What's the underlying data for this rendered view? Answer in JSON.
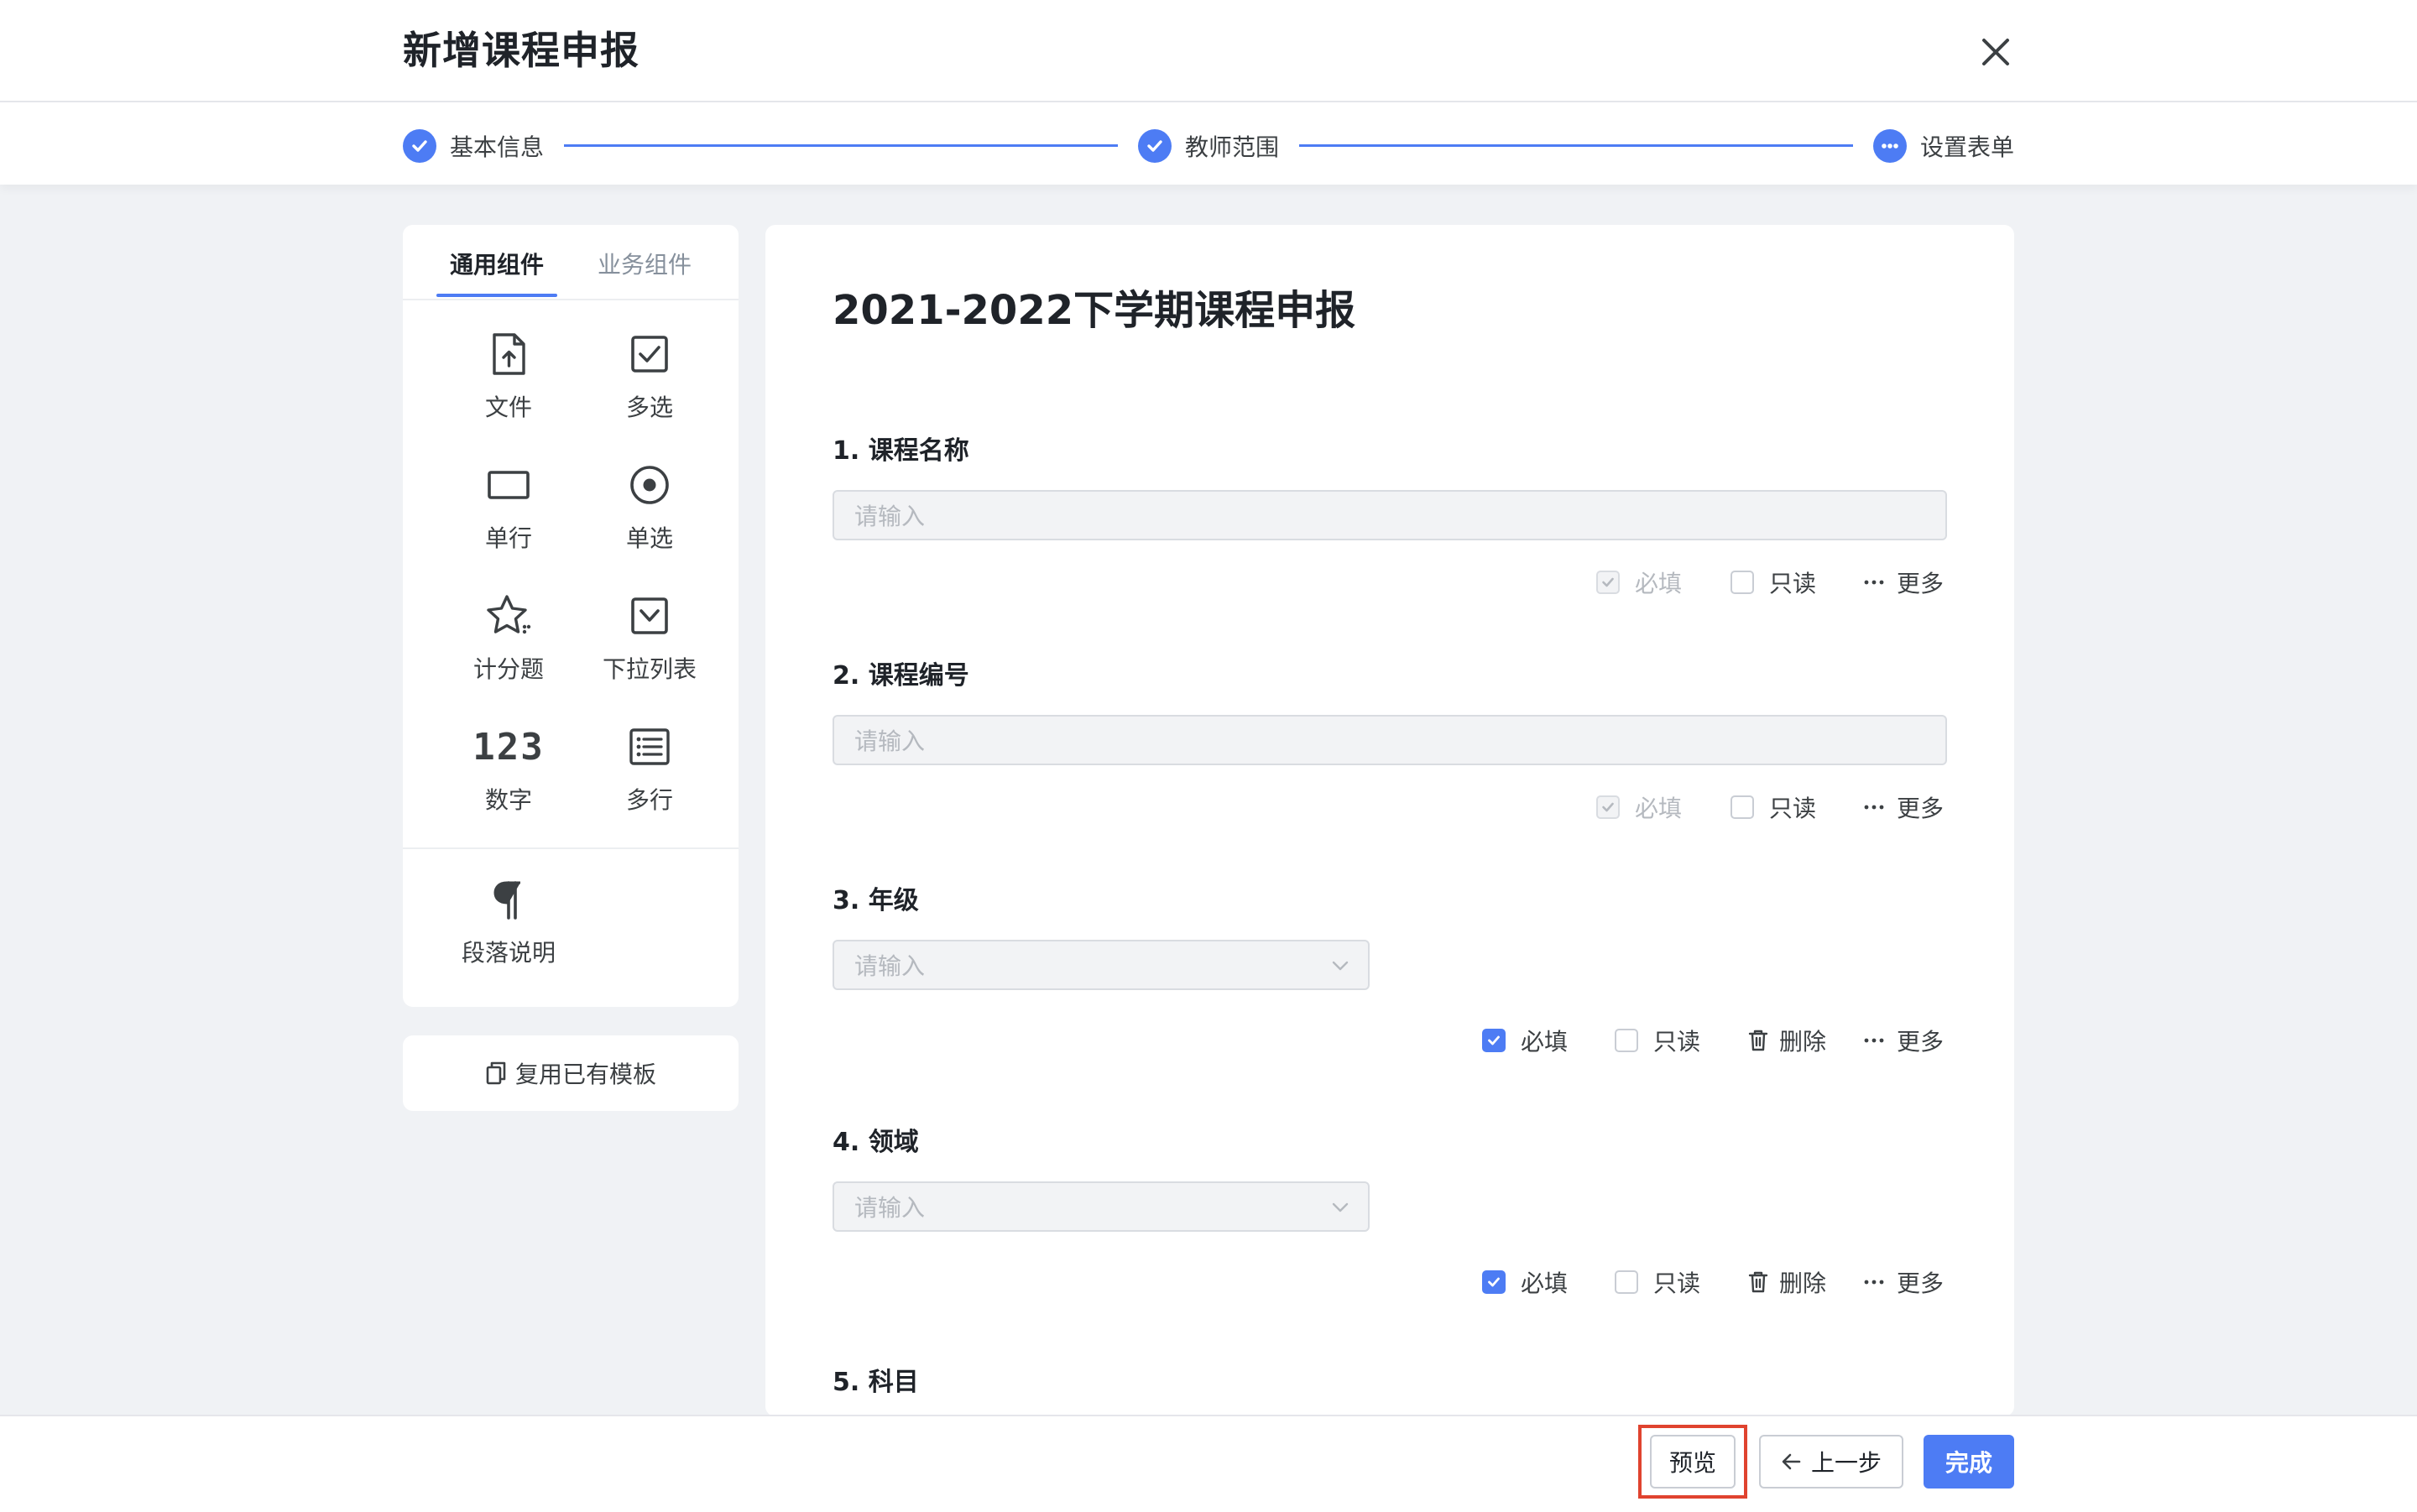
{
  "header": {
    "title": "新增课程申报"
  },
  "steps": [
    {
      "label": "基本信息",
      "status": "done"
    },
    {
      "label": "教师范围",
      "status": "done"
    },
    {
      "label": "设置表单",
      "status": "current"
    }
  ],
  "palette": {
    "tabs": [
      "通用组件",
      "业务组件"
    ],
    "active_tab": "通用组件",
    "components": [
      {
        "label": "文件",
        "icon": "file-upload-icon"
      },
      {
        "label": "多选",
        "icon": "checkbox-icon"
      },
      {
        "label": "单行",
        "icon": "single-line-icon"
      },
      {
        "label": "单选",
        "icon": "radio-icon"
      },
      {
        "label": "计分题",
        "icon": "star-score-icon"
      },
      {
        "label": "下拉列表",
        "icon": "dropdown-icon"
      },
      {
        "label": "数字",
        "icon": "number-icon",
        "glyph": "123"
      },
      {
        "label": "多行",
        "icon": "multiline-icon"
      },
      {
        "label": "段落说明",
        "icon": "paragraph-icon",
        "glyph": "¶"
      }
    ],
    "reuse_label": "复用已有模板"
  },
  "form": {
    "title": "2021-2022下学期课程申报",
    "questions": [
      {
        "label": "1. 课程名称",
        "placeholder": "请输入",
        "type": "text"
      },
      {
        "label": "2. 课程编号",
        "placeholder": "请输入",
        "type": "text"
      },
      {
        "label": "3. 年级",
        "placeholder": "请输入",
        "type": "select"
      },
      {
        "label": "4. 领域",
        "placeholder": "请输入",
        "type": "select"
      },
      {
        "label": "5. 科目"
      }
    ],
    "options": {
      "required": "必填",
      "readonly": "只读",
      "delete": "删除",
      "more": "更多"
    }
  },
  "footer": {
    "preview": "预览",
    "prev": "上一步",
    "finish": "完成"
  },
  "colors": {
    "primary": "#4d7cf4",
    "highlight": "#e0432f",
    "background": "#f0f2f5"
  }
}
